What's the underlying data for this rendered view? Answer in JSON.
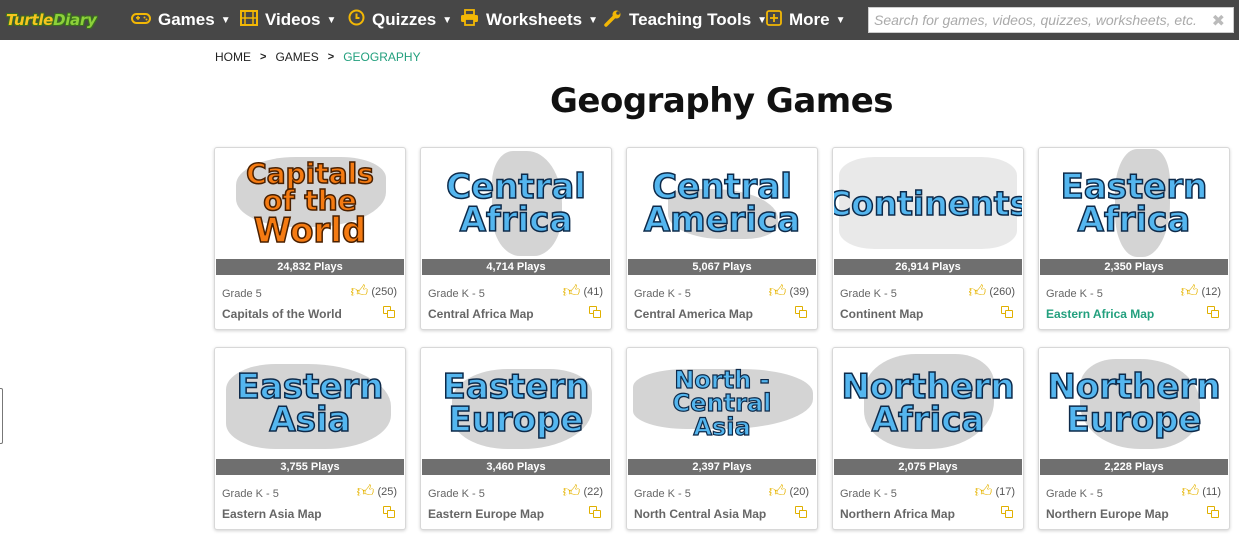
{
  "logo": {
    "part1": "Turtle",
    "part2": "Diary"
  },
  "nav": [
    {
      "label": "Games",
      "icon": "gamepad-icon"
    },
    {
      "label": "Videos",
      "icon": "film-icon"
    },
    {
      "label": "Quizzes",
      "icon": "clock-icon"
    },
    {
      "label": "Worksheets",
      "icon": "printer-icon"
    },
    {
      "label": "Teaching Tools",
      "icon": "wrench-icon"
    },
    {
      "label": "More",
      "icon": "plus-square-icon"
    }
  ],
  "search": {
    "placeholder": "Search for games, videos, quizzes, worksheets, etc.",
    "value": "",
    "clear": "✖"
  },
  "breadcrumb": [
    "HOME",
    "GAMES",
    "GEOGRAPHY"
  ],
  "page_title": "Geography Games",
  "colors": {
    "topbar": "#474747",
    "accent": "#23a07e",
    "icon_gold": "#f2b705",
    "title_blue": "#54b6ef",
    "title_orange": "#f57b12"
  },
  "games": [
    {
      "thumb_lines": [
        "Capitals",
        "of the",
        "World"
      ],
      "plays": "24,832 Plays",
      "grade": "Grade 5",
      "likes": "(250)",
      "name": "Capitals of the World"
    },
    {
      "thumb_lines": [
        "Central",
        "Africa"
      ],
      "plays": "4,714 Plays",
      "grade": "Grade K - 5",
      "likes": "(41)",
      "name": "Central Africa Map"
    },
    {
      "thumb_lines": [
        "Central",
        "America"
      ],
      "plays": "5,067 Plays",
      "grade": "Grade K - 5",
      "likes": "(39)",
      "name": "Central America Map"
    },
    {
      "thumb_lines": [
        "Continents"
      ],
      "plays": "26,914 Plays",
      "grade": "Grade K - 5",
      "likes": "(260)",
      "name": "Continent Map"
    },
    {
      "thumb_lines": [
        "Eastern",
        "Africa"
      ],
      "plays": "2,350 Plays",
      "grade": "Grade K - 5",
      "likes": "(12)",
      "name": "Eastern Africa Map"
    },
    {
      "thumb_lines": [
        "Eastern",
        "Asia"
      ],
      "plays": "3,755 Plays",
      "grade": "Grade K - 5",
      "likes": "(25)",
      "name": "Eastern Asia Map"
    },
    {
      "thumb_lines": [
        "Eastern",
        "Europe"
      ],
      "plays": "3,460 Plays",
      "grade": "Grade K - 5",
      "likes": "(22)",
      "name": "Eastern Europe Map"
    },
    {
      "thumb_lines": [
        "North - Central",
        "Asia"
      ],
      "plays": "2,397 Plays",
      "grade": "Grade K - 5",
      "likes": "(20)",
      "name": "North Central Asia Map"
    },
    {
      "thumb_lines": [
        "Northern",
        "Africa"
      ],
      "plays": "2,075 Plays",
      "grade": "Grade K - 5",
      "likes": "(17)",
      "name": "Northern Africa Map"
    },
    {
      "thumb_lines": [
        "Northern",
        "Europe"
      ],
      "plays": "2,228 Plays",
      "grade": "Grade K - 5",
      "likes": "(11)",
      "name": "Northern Europe Map"
    }
  ]
}
